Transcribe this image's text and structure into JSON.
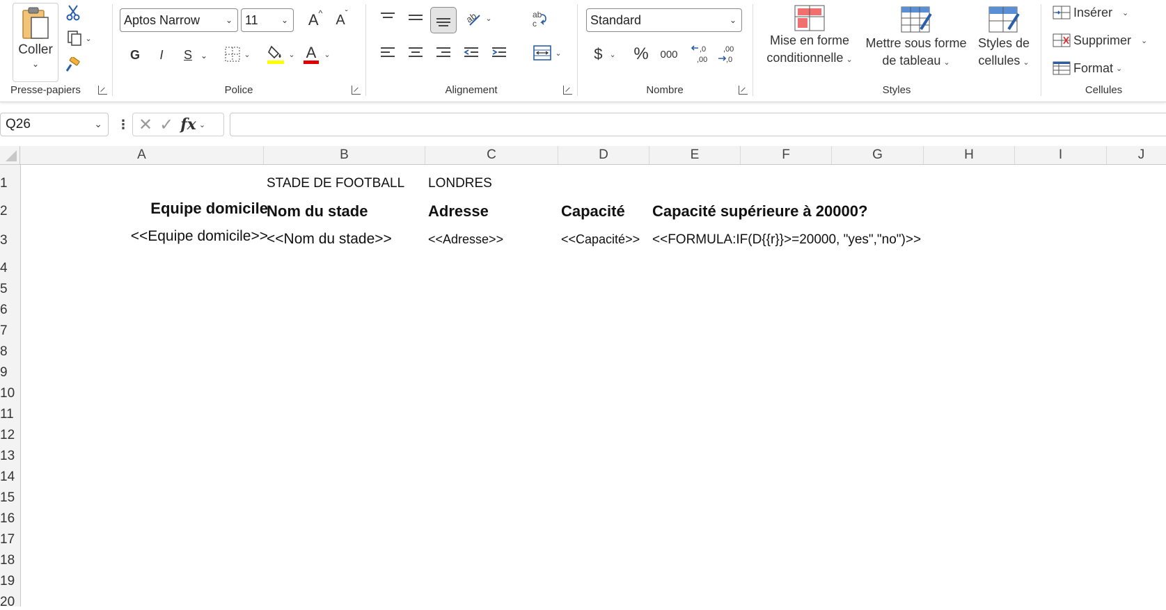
{
  "ribbon": {
    "clipboard": {
      "paste_label": "Coller",
      "group_label": "Presse-papiers"
    },
    "font": {
      "family": "Aptos Narrow",
      "size": "11",
      "bold": "G",
      "italic": "I",
      "underline": "S",
      "group_label": "Police",
      "highlight_color": "#ffff00",
      "font_color": "#e00000"
    },
    "alignment": {
      "group_label": "Alignement"
    },
    "number": {
      "format": "Standard",
      "currency": "$",
      "percent": "%",
      "thousands": "000",
      "group_label": "Nombre"
    },
    "styles": {
      "conditional": "Mise en forme conditionnelle",
      "conditional_l1": "Mise en forme",
      "conditional_l2": "conditionnelle",
      "table_l1": "Mettre sous forme",
      "table_l2": "de tableau",
      "cell_l1": "Styles de",
      "cell_l2": "cellules",
      "group_label": "Styles"
    },
    "cells": {
      "insert": "Insérer",
      "delete": "Supprimer",
      "format": "Format",
      "group_label": "Cellules"
    }
  },
  "formula_bar": {
    "name_box": "Q26",
    "fx": "fx",
    "formula": ""
  },
  "columns": [
    "A",
    "B",
    "C",
    "D",
    "E",
    "F",
    "G",
    "H",
    "I",
    "J"
  ],
  "rows": [
    "1",
    "2",
    "3",
    "4",
    "5",
    "6",
    "7",
    "8",
    "9",
    "10",
    "11",
    "12",
    "13",
    "14",
    "15",
    "16",
    "17",
    "18",
    "19",
    "20"
  ],
  "cells": {
    "B1": "STADE DE FOOTBALL",
    "C1": "LONDRES",
    "A2": "Equipe domicile",
    "B2": "Nom du stade",
    "C2": "Adresse",
    "D2": "Capacité",
    "E2": "Capacité supérieure à 20000?",
    "A3": "<<Equipe domicile>>",
    "B3": "<<Nom du stade>>",
    "C3": "<<Adresse>>",
    "D3": "<<Capacité>>",
    "E3": "<<FORMULA:IF(D{{r}}>=20000, \"yes\",\"no\")>>"
  }
}
